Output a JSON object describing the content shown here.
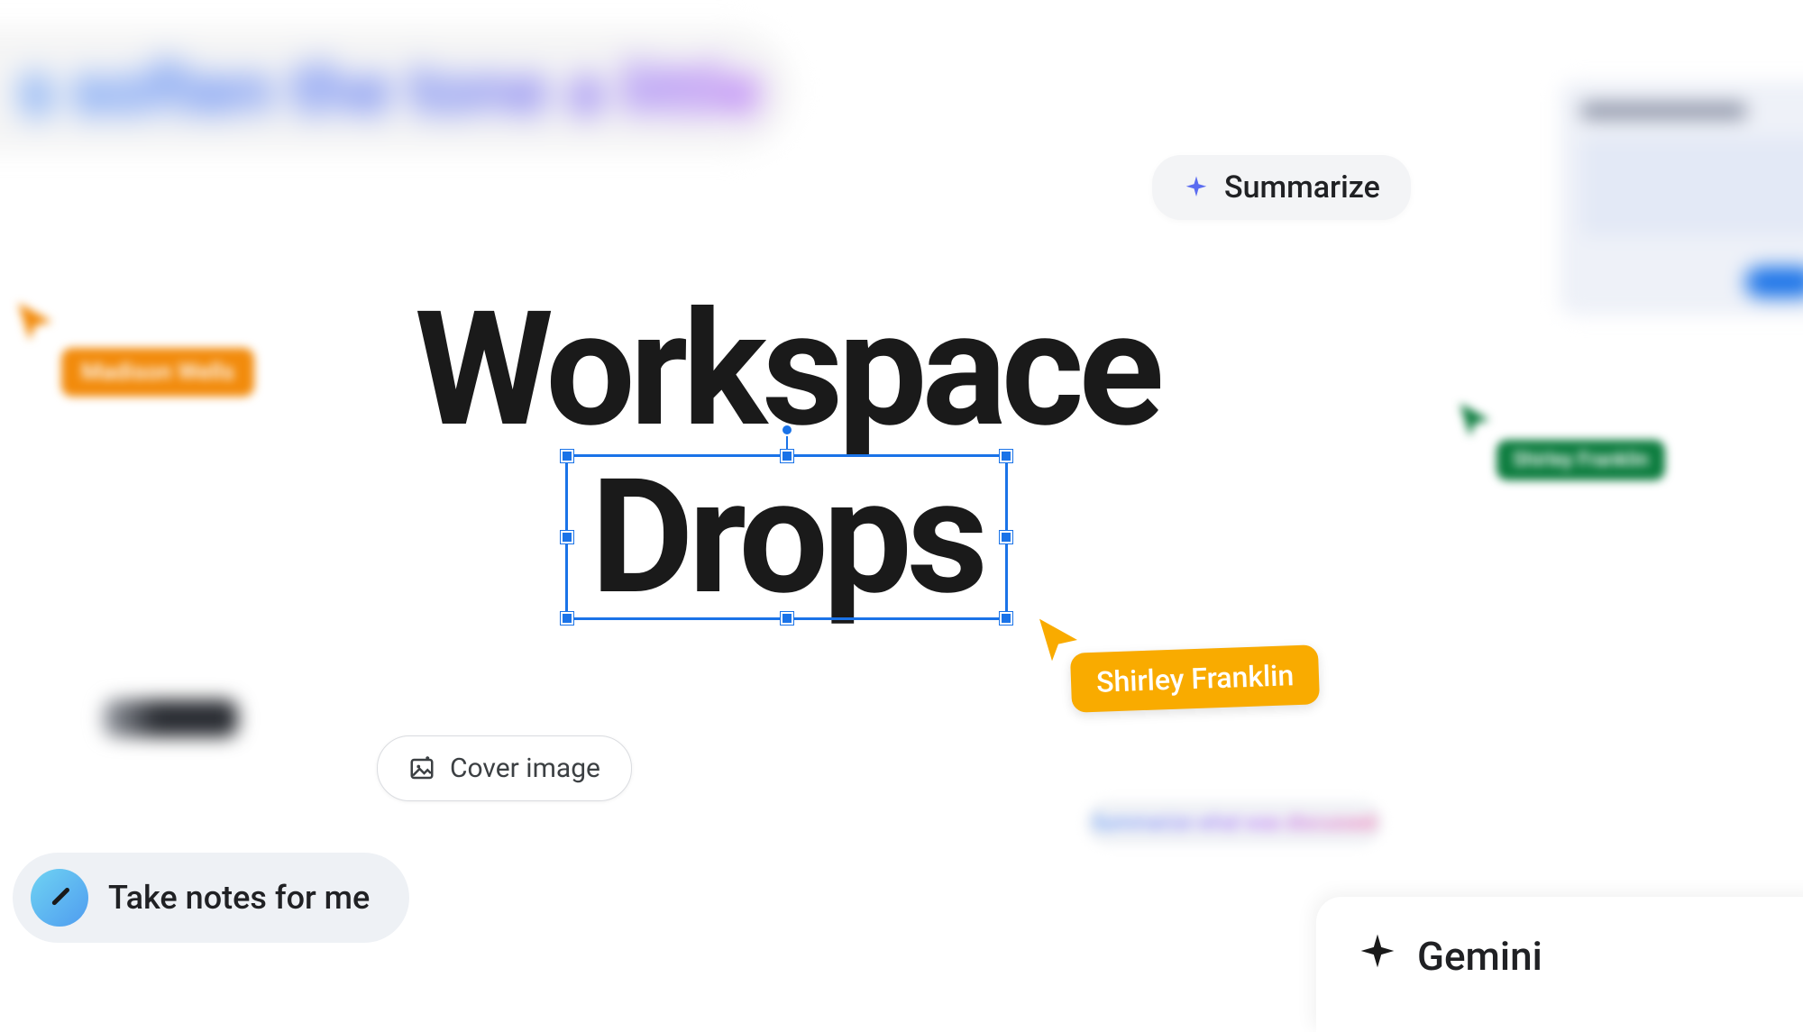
{
  "blurred": {
    "topleft_text": "s soften the tone a little",
    "midright_text": "Summarize what was discussed"
  },
  "chips": {
    "summarize_label": "Summarize",
    "cover_image_label": "Cover image",
    "take_notes_label": "Take notes for me",
    "gemini_label": "Gemini"
  },
  "cursors": {
    "orange_user": "Madison Wells",
    "green_user": "Shirley Franklin",
    "yellow_user": "Shirley Franklin"
  },
  "title": {
    "line1": "Workspace",
    "line2": "Drops"
  },
  "colors": {
    "orange": "#f28b0c",
    "green": "#0d7d3f",
    "yellow": "#f9ab00",
    "blue": "#1a73e8"
  }
}
